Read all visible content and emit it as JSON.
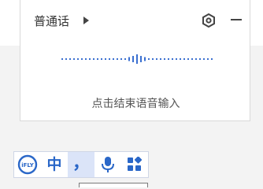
{
  "panel": {
    "language": "普通话",
    "hint": "点击结束语音输入"
  },
  "toolbar": {
    "logo_text": "iFLY",
    "chinese_mode": "中",
    "punctuation": "，"
  },
  "colors": {
    "accent": "#2a67c8",
    "active_bg": "#dbe4f8",
    "wave": "#3a6fd0"
  },
  "icons": [
    "expand-arrow-icon",
    "settings-icon",
    "minimize-icon",
    "ifly-logo-icon",
    "microphone-icon",
    "apps-grid-icon"
  ]
}
